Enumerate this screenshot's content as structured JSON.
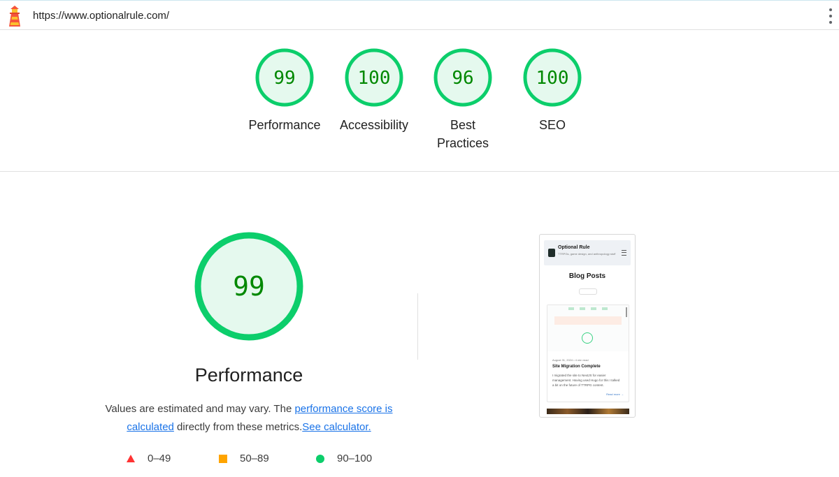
{
  "topbar": {
    "url": "https://www.optionalrule.com/",
    "logo_icon": "lighthouse-icon",
    "menu_icon": "more-vert-icon"
  },
  "categories": [
    {
      "score": "99",
      "label": "Performance"
    },
    {
      "score": "100",
      "label": "Accessibility"
    },
    {
      "score": "96",
      "label": "Best Practices"
    },
    {
      "score": "100",
      "label": "SEO"
    }
  ],
  "performance": {
    "score": "99",
    "title": "Performance",
    "note_prefix": "Values are estimated and may vary. The ",
    "note_link1": "performance score is calculated",
    "note_middle": " directly from these metrics.",
    "note_link2": "See calculator."
  },
  "legend": [
    {
      "shape": "triangle",
      "range": "0–49",
      "color": "#ff3333"
    },
    {
      "shape": "square",
      "range": "50–89",
      "color": "#ffa400"
    },
    {
      "shape": "circle",
      "range": "90–100",
      "color": "#0cce6b"
    }
  ],
  "screenshot": {
    "site_title": "Optional Rule",
    "site_subtitle": "TTRPGs, game design, and anthropology stuff",
    "heading": "Blog Posts",
    "post_meta": "August 31, 2024  •  4 min read",
    "post_title": "Site Migration Complete",
    "post_text": "I migrated the site to NextJS for easier management. Having used Hugo for this I talked a bit on the future of TTRPG content.",
    "read_more": "Read more →"
  },
  "colors": {
    "pass_green": "#0cce6b",
    "score_text": "#008800",
    "gauge_fill": "#e5f9ee",
    "link": "#1a73e8"
  }
}
